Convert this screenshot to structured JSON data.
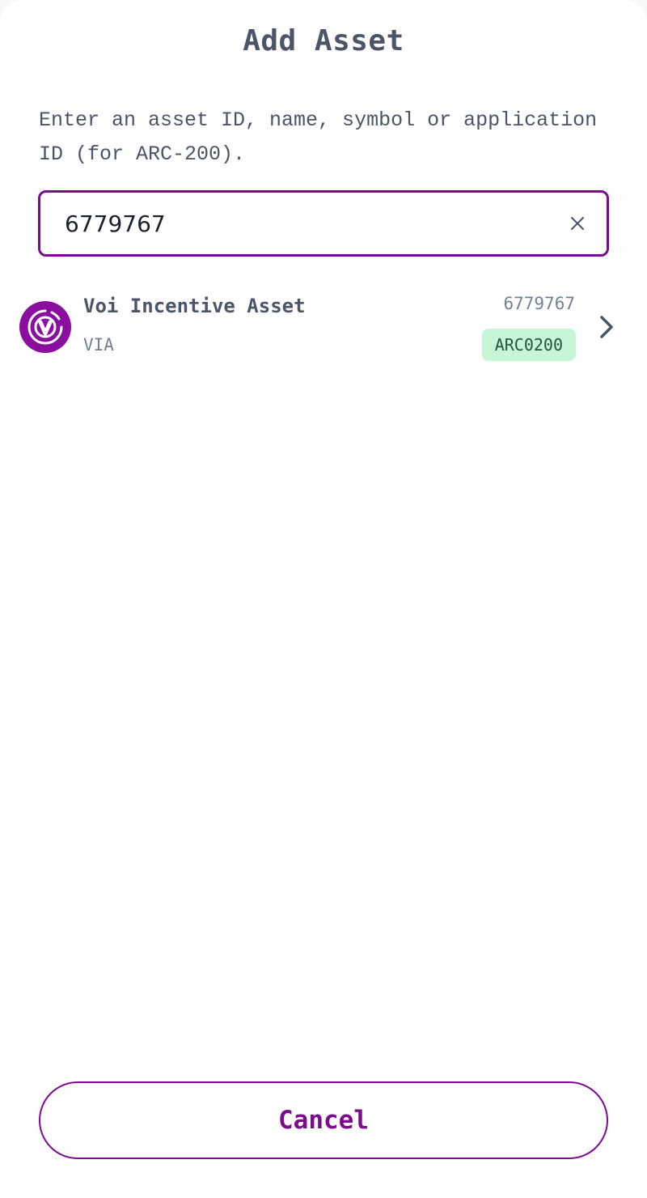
{
  "dialog": {
    "title": "Add Asset",
    "instructions": "Enter an asset ID, name, symbol or application ID (for ARC-200)."
  },
  "search": {
    "value": "6779767",
    "clear_icon": "close-icon"
  },
  "results": [
    {
      "name": "Voi Incentive Asset",
      "symbol": "VIA",
      "id": "6779767",
      "standard": "ARC0200",
      "icon": "voi-logo-icon",
      "action_icon": "chevron-right-icon"
    }
  ],
  "footer": {
    "cancel_label": "Cancel"
  },
  "colors": {
    "accent": "#7d0b8f",
    "text_primary": "#4a5568",
    "text_secondary": "#718096",
    "badge_bg": "#c6f6d5",
    "badge_text": "#22543d"
  }
}
